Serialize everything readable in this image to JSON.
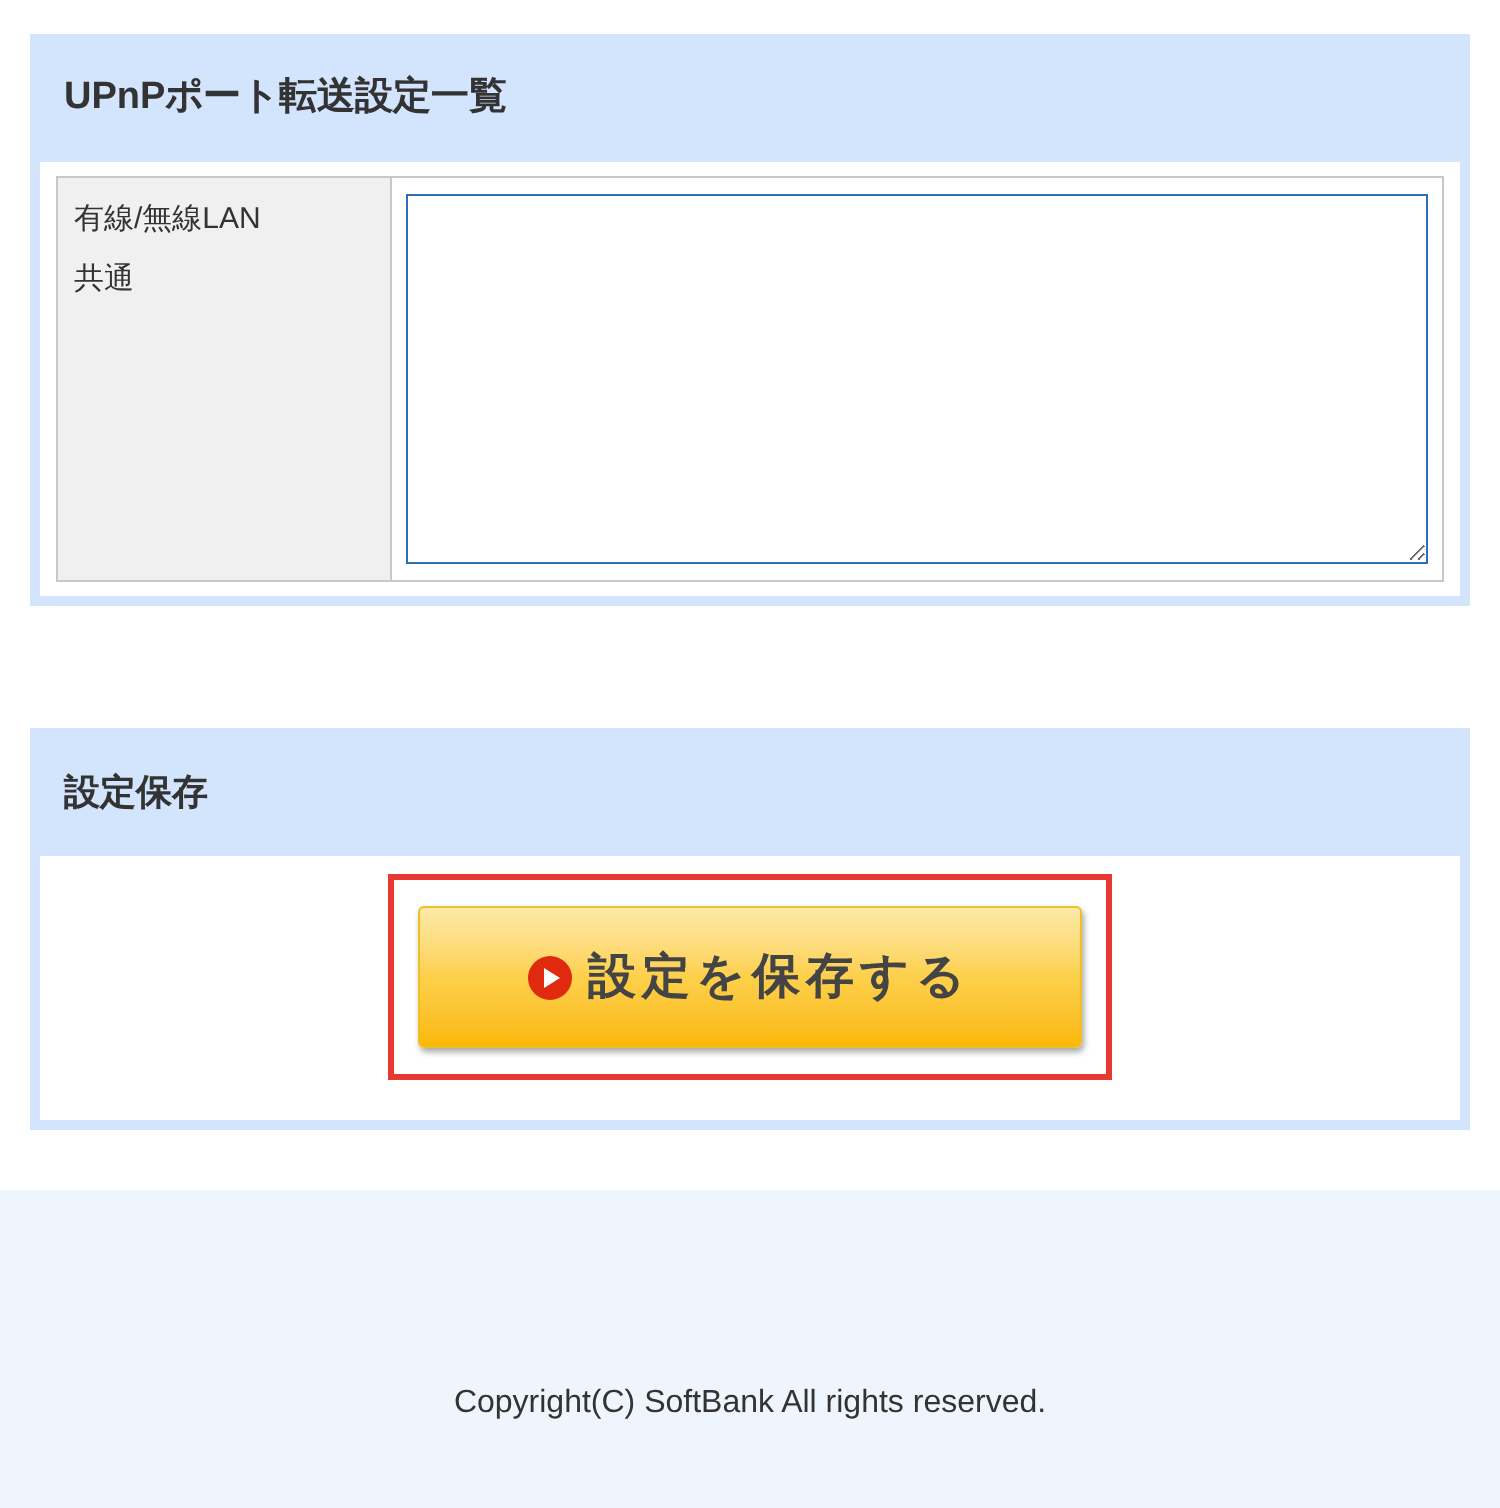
{
  "sections": [
    {
      "kind": "table",
      "title": "UPnPポート転送設定一覧",
      "rows": [
        {
          "label_lines": [
            "有線/無線LAN",
            "共通"
          ],
          "value": ""
        }
      ]
    },
    {
      "kind": "action",
      "title": "設定保存",
      "button": {
        "label": "設定を保存する",
        "highlighted": true
      }
    }
  ],
  "footer": {
    "copyright": "Copyright(C) SoftBank All rights reserved."
  }
}
